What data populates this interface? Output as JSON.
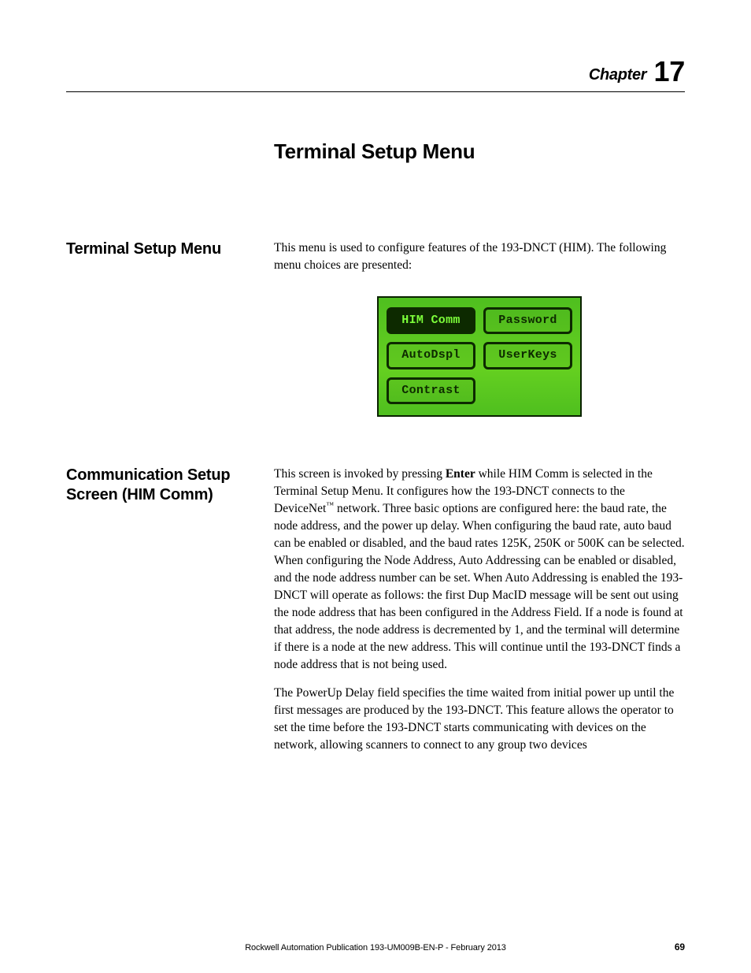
{
  "header": {
    "chapter_word": "Chapter",
    "chapter_number": "17"
  },
  "page_title": "Terminal Setup Menu",
  "sections": [
    {
      "heading": "Terminal Setup Menu",
      "intro": "This menu is used to configure features of the 193-DNCT (HIM). The following menu choices are presented:",
      "lcd": {
        "rows": [
          [
            {
              "label": "HIM Comm",
              "selected": true
            },
            {
              "label": "Password",
              "selected": false
            }
          ],
          [
            {
              "label": "AutoDspl",
              "selected": false
            },
            {
              "label": "UserKeys",
              "selected": false
            }
          ],
          [
            {
              "label": "Contrast",
              "selected": false
            },
            {
              "label": "",
              "empty": true
            }
          ]
        ]
      }
    },
    {
      "heading": "Communication Setup Screen (HIM Comm)",
      "p1a": "This screen is invoked by pressing ",
      "p1_bold": "Enter",
      "p1b": " while HIM Comm is selected in the Terminal Setup Menu. It configures how the 193-DNCT connects to the DeviceNet",
      "tm": "™",
      "p1c": " network. Three basic options are configured here: the baud rate, the node address, and the power up delay. When configuring the baud rate, auto baud can be enabled or disabled, and the baud rates 125K, 250K or 500K can be selected. When configuring the Node Address, Auto Addressing can be enabled or disabled, and the node address number can be set. When Auto Addressing is enabled the 193-DNCT will operate as follows: the first Dup MacID message will be sent out using the node address that has been configured in the Address Field. If a node is found at that address, the node address is decremented by 1, and the terminal will determine if there is a node at the new address. This will continue until the 193-DNCT finds a node address that is not being used.",
      "p2": "The PowerUp Delay field specifies the time waited from initial power up until the first messages are produced by the 193-DNCT. This feature allows the operator to set the time before the 193-DNCT starts communicating with devices on the network, allowing scanners to connect to any group two devices"
    }
  ],
  "footer": {
    "publication": "Rockwell Automation Publication 193-UM009B-EN-P - February 2013",
    "page_number": "69"
  }
}
